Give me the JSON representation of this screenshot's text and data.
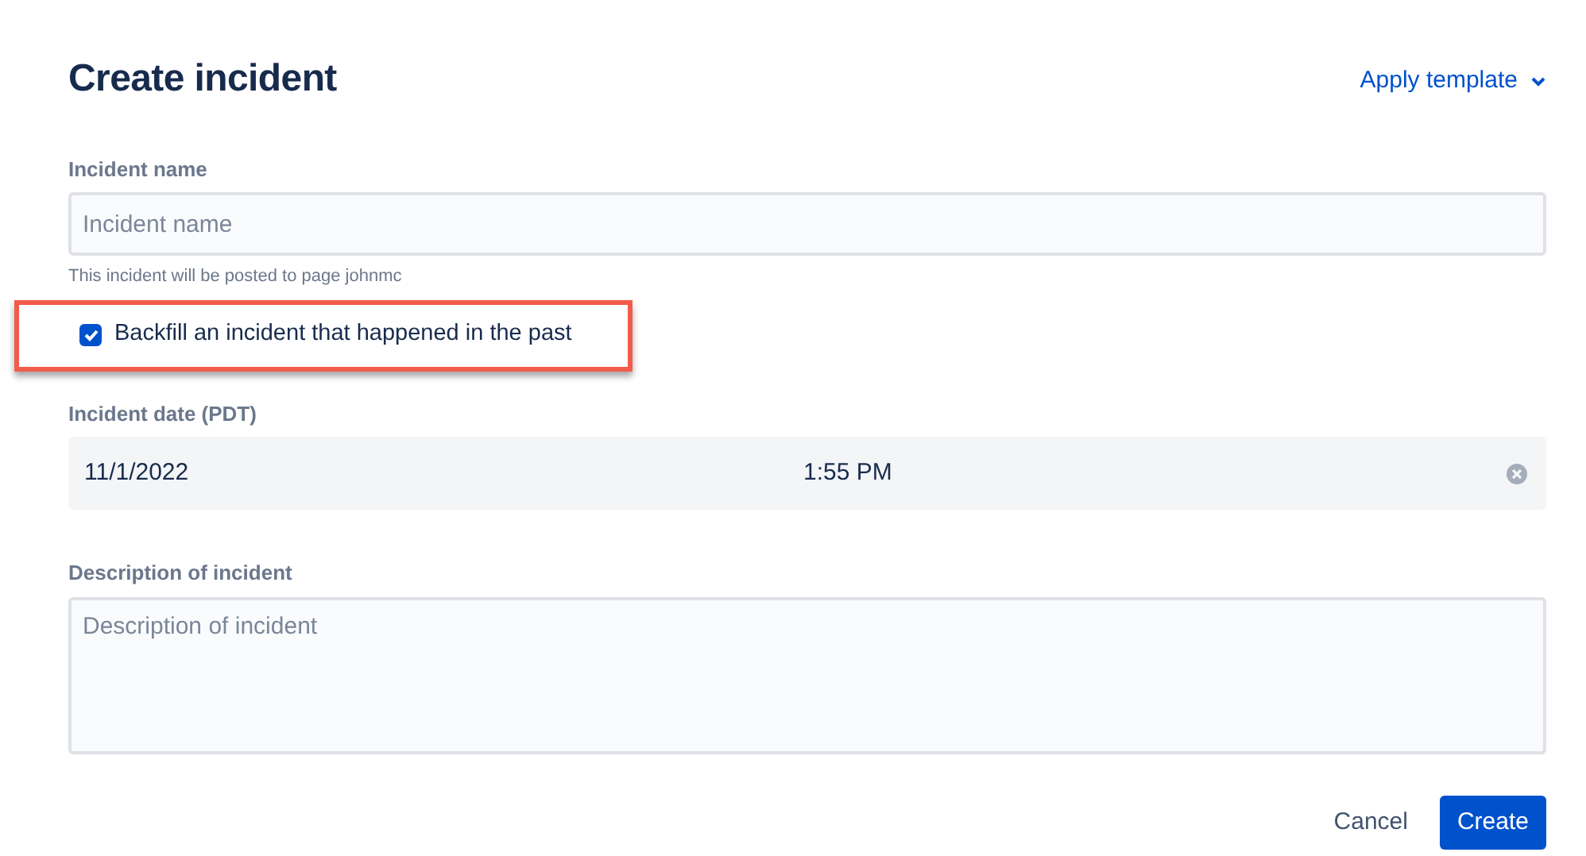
{
  "title": "Create incident",
  "apply_template": {
    "label": "Apply template"
  },
  "incident_name": {
    "label": "Incident name",
    "placeholder": "Incident name",
    "hint": "This incident will be posted to page johnmc"
  },
  "backfill": {
    "label": "Backfill an incident that happened in the past",
    "checked": true,
    "highlighted": true
  },
  "incident_date": {
    "label": "Incident date (PDT)",
    "date": "11/1/2022",
    "time": "1:55 PM"
  },
  "description": {
    "label": "Description of incident",
    "placeholder": "Description of incident"
  },
  "buttons": [
    {
      "label": "Cancel",
      "kind": "subtle"
    },
    {
      "label": "Create",
      "kind": "primary"
    }
  ]
}
